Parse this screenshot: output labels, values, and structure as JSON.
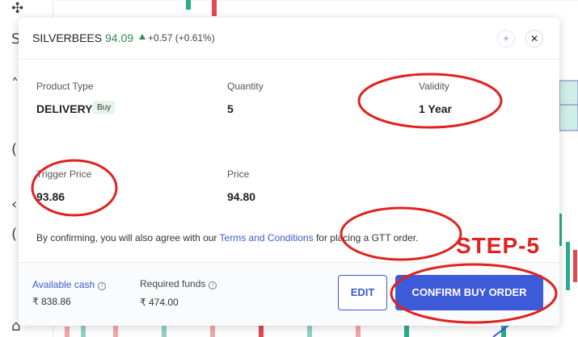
{
  "order": {
    "symbol": "SILVERBEES",
    "ltp": "94.09",
    "change": "+0.57 (+0.61%)",
    "fields": {
      "product_type_label": "Product Type",
      "product_type_value": "DELIVERY",
      "product_tag": "Buy",
      "quantity_label": "Quantity",
      "quantity_value": "5",
      "validity_label": "Validity",
      "validity_value": "1 Year",
      "trigger_label": "Trigger Price",
      "trigger_value": "93.86",
      "price_label": "Price",
      "price_value": "94.80"
    },
    "confirm": {
      "prefix": "By confirming, you will also agree with our ",
      "link": "Terms and Conditions",
      "suffix": " for placing a GTT order."
    },
    "footer": {
      "available_label": "Available cash",
      "available_value": "₹ 838.86",
      "required_label": "Required funds",
      "required_value": "₹ 474.00",
      "edit_label": "EDIT",
      "confirm_label": "CONFIRM BUY ORDER"
    }
  },
  "annotation": {
    "step_label": "STEP-5",
    "color": "#e0221f"
  },
  "icons": {
    "up": "triangle-up-icon",
    "sparkle": "sparkle-icon",
    "close": "close-icon",
    "info": "info-icon"
  },
  "colors": {
    "accent": "#3d5bd9",
    "positive": "#2e8b57",
    "link": "#3b5bcc"
  }
}
